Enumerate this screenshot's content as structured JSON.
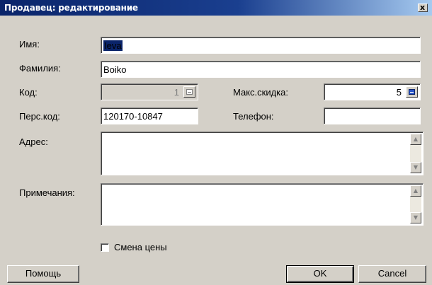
{
  "window": {
    "title": "Продавец: редактирование",
    "close_label": "x"
  },
  "fields": {
    "name": {
      "label": "Имя:",
      "value": "Ieva"
    },
    "surname": {
      "label": "Фамилия:",
      "value": "Boiko"
    },
    "code": {
      "label": "Код:",
      "value": "1"
    },
    "max_discount": {
      "label": "Макс.скидка:",
      "value": "5"
    },
    "personal_code": {
      "label": "Перс.код:",
      "value": "120170-10847"
    },
    "phone": {
      "label": "Телефон:",
      "value": ""
    },
    "address": {
      "label": "Адрес:",
      "value": ""
    },
    "notes": {
      "label": "Примечания:",
      "value": ""
    }
  },
  "checkbox": {
    "label": "Смена цены",
    "checked": false
  },
  "buttons": {
    "help": "Помощь",
    "ok": "OK",
    "cancel": "Cancel"
  },
  "icons": {
    "spin": "calculator-icon",
    "scroll_up": "scroll-up-arrow-icon",
    "scroll_down": "scroll-down-arrow-icon",
    "close": "close-icon"
  },
  "colors": {
    "title_start": "#0a246a",
    "title_end": "#a6caf0",
    "face": "#d4d0c8",
    "selection": "#0a246a"
  }
}
